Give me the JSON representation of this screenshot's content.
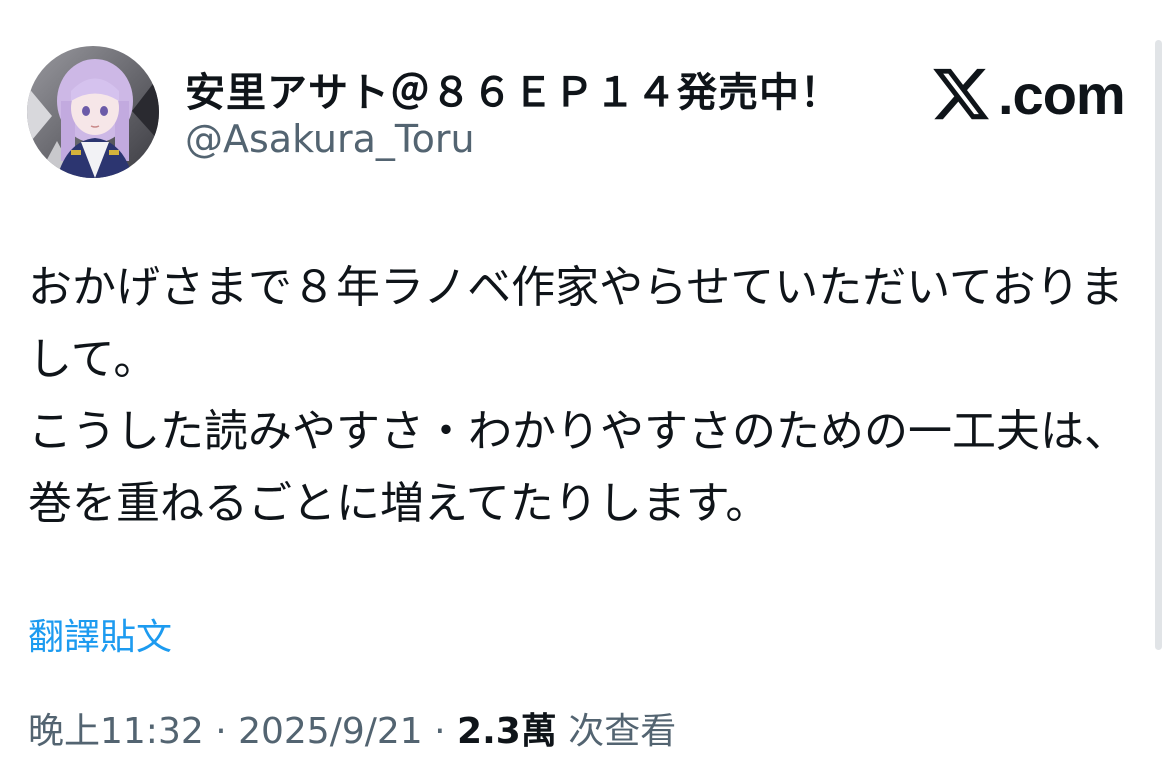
{
  "tweet": {
    "author": {
      "display_name": "安里アサト＠８６ＥＰ１４発売中！",
      "handle": "@Asakura_Toru"
    },
    "brand": {
      "label": ".com",
      "icon": "x-logo-icon"
    },
    "text": "おかげさまで８年ラノベ作家やらせていただいておりまして。\nこうした読みやすさ・わかりやすさのための一工夫は、巻を重ねるごとに増えてたりします。",
    "translate_label": "翻譯貼文",
    "meta": {
      "time": "晚上11:32",
      "separator": " · ",
      "date": "2025/9/21",
      "views_count": "2.3萬",
      "views_label": " 次查看"
    }
  },
  "colors": {
    "text": "#0f1419",
    "secondary": "#536471",
    "link": "#1d9bf0",
    "background": "#ffffff"
  }
}
